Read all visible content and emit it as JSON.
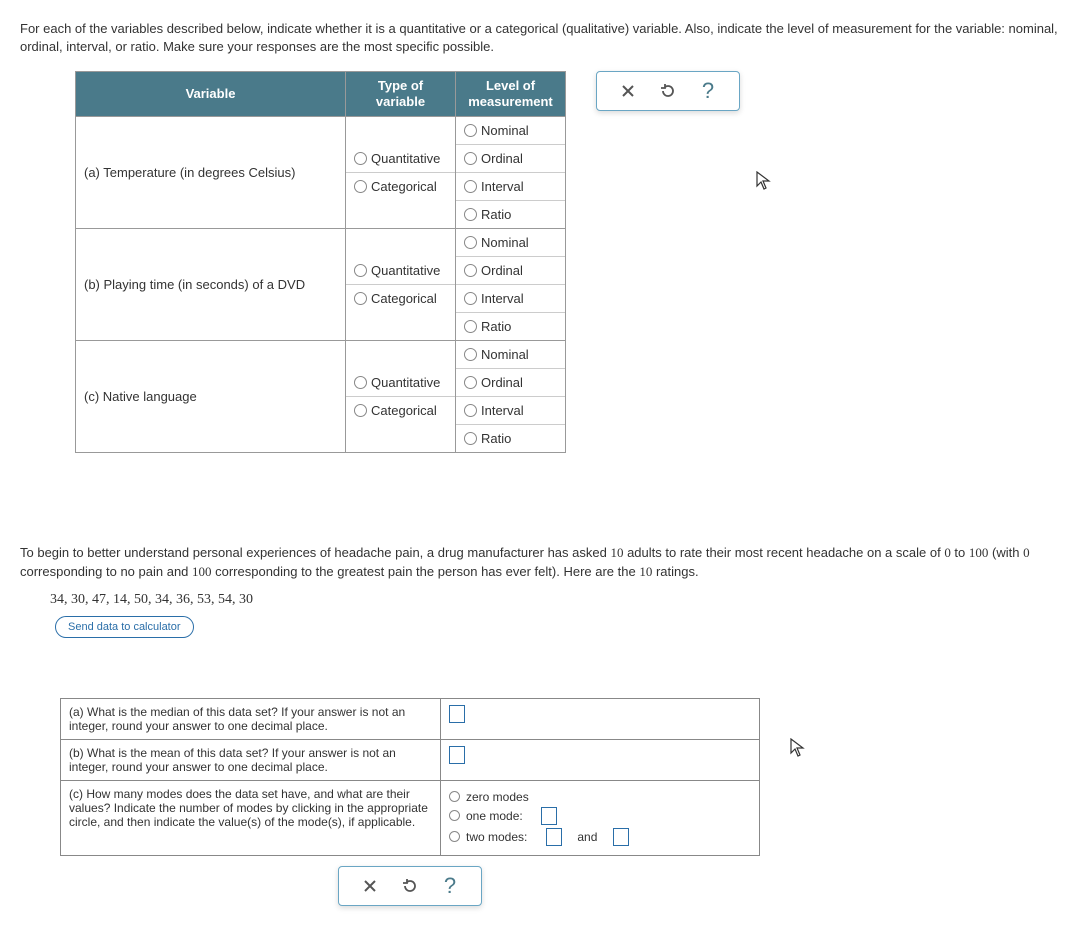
{
  "q1": {
    "instructions": "For each of the variables described below, indicate whether it is a quantitative or a categorical (qualitative) variable. Also, indicate the level of measurement for the variable: nominal, ordinal, interval, or ratio. Make sure your responses are the most specific possible.",
    "headers": {
      "variable": "Variable",
      "type": "Type of variable",
      "level": "Level of measurement"
    },
    "type_options": {
      "quantitative": "Quantitative",
      "categorical": "Categorical"
    },
    "level_options": {
      "nominal": "Nominal",
      "ordinal": "Ordinal",
      "interval": "Interval",
      "ratio": "Ratio"
    },
    "rows": [
      {
        "label": "(a) Temperature (in degrees Celsius)"
      },
      {
        "label": "(b) Playing time (in seconds) of a DVD"
      },
      {
        "label": "(c) Native language"
      }
    ]
  },
  "toolbar": {
    "close": "✕",
    "reset": "↺",
    "help": "?"
  },
  "q2": {
    "intro_a": "To begin to better understand personal experiences of headache pain, a drug manufacturer has asked ",
    "n1": "10",
    "intro_b": " adults to rate their most recent headache on a scale of ",
    "zero": "0",
    "intro_c": " to ",
    "hundred": "100",
    "intro_d": " (with ",
    "zero2": "0",
    "intro_e": " corresponding to no pain and ",
    "hundred2": "100",
    "intro_f": " corresponding to the greatest pain the person has ever felt). Here are the ",
    "n2": "10",
    "intro_g": " ratings.",
    "data": "34, 30, 47, 14, 50, 34, 36, 53, 54, 30",
    "send_label": "Send data to calculator",
    "parts": {
      "a": "(a) What is the median of this data set? If your answer is not an integer, round your answer to one decimal place.",
      "b": "(b) What is the mean of this data set? If your answer is not an integer, round your answer to one decimal place.",
      "c": "(c) How many modes does the data set have, and what are their values? Indicate the number of modes by clicking in the appropriate circle, and then indicate the value(s) of the mode(s), if applicable."
    },
    "modes": {
      "zero": "zero modes",
      "one": "one mode:",
      "two": "two modes:",
      "and": "and"
    }
  }
}
